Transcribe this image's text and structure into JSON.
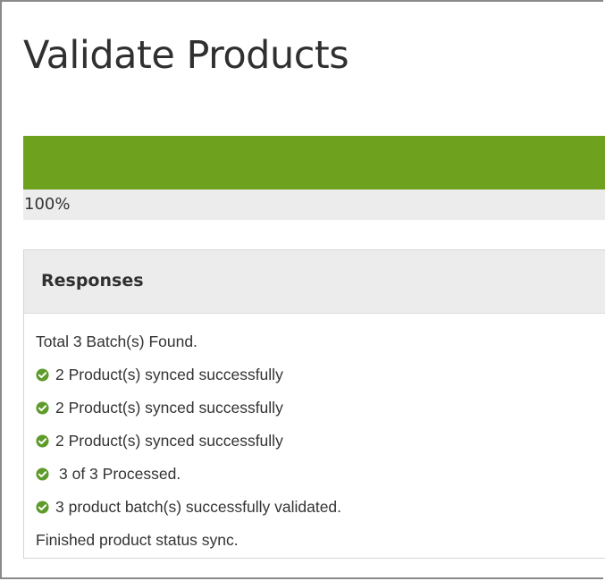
{
  "page": {
    "title": "Validate Products"
  },
  "progress": {
    "percent": 100,
    "label": "100%",
    "fill_color": "#6ea11e"
  },
  "responses": {
    "heading": "Responses",
    "lines": [
      {
        "text": "Total 3 Batch(s) Found.",
        "icon": null
      },
      {
        "text": "2 Product(s) synced successfully",
        "icon": "check-circle-icon"
      },
      {
        "text": "2 Product(s) synced successfully",
        "icon": "check-circle-icon"
      },
      {
        "text": "2 Product(s) synced successfully",
        "icon": "check-circle-icon"
      },
      {
        "text": "3 of 3 Processed.",
        "icon": "check-circle-icon"
      },
      {
        "text": "3 product batch(s) successfully validated.",
        "icon": "check-circle-icon"
      },
      {
        "text": "Finished product status sync.",
        "icon": null
      }
    ]
  },
  "colors": {
    "success": "#5f9b2b"
  }
}
